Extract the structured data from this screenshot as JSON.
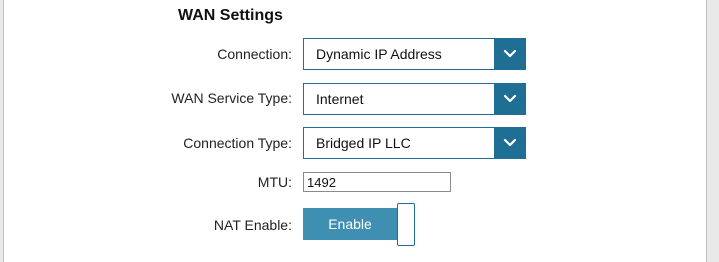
{
  "section": {
    "title": "WAN Settings"
  },
  "connection": {
    "label": "Connection:",
    "value": "Dynamic IP Address"
  },
  "wan_service_type": {
    "label": "WAN Service Type:",
    "value": "Internet"
  },
  "connection_type": {
    "label": "Connection Type:",
    "value": "Bridged IP LLC"
  },
  "mtu": {
    "label": "MTU:",
    "value": "1492"
  },
  "nat": {
    "label": "NAT Enable:",
    "button_label": "Enable"
  },
  "colors": {
    "accent": "#1f6e94",
    "button": "#3f8fb2"
  },
  "icons": {
    "dropdown": "chevron-down-icon"
  }
}
